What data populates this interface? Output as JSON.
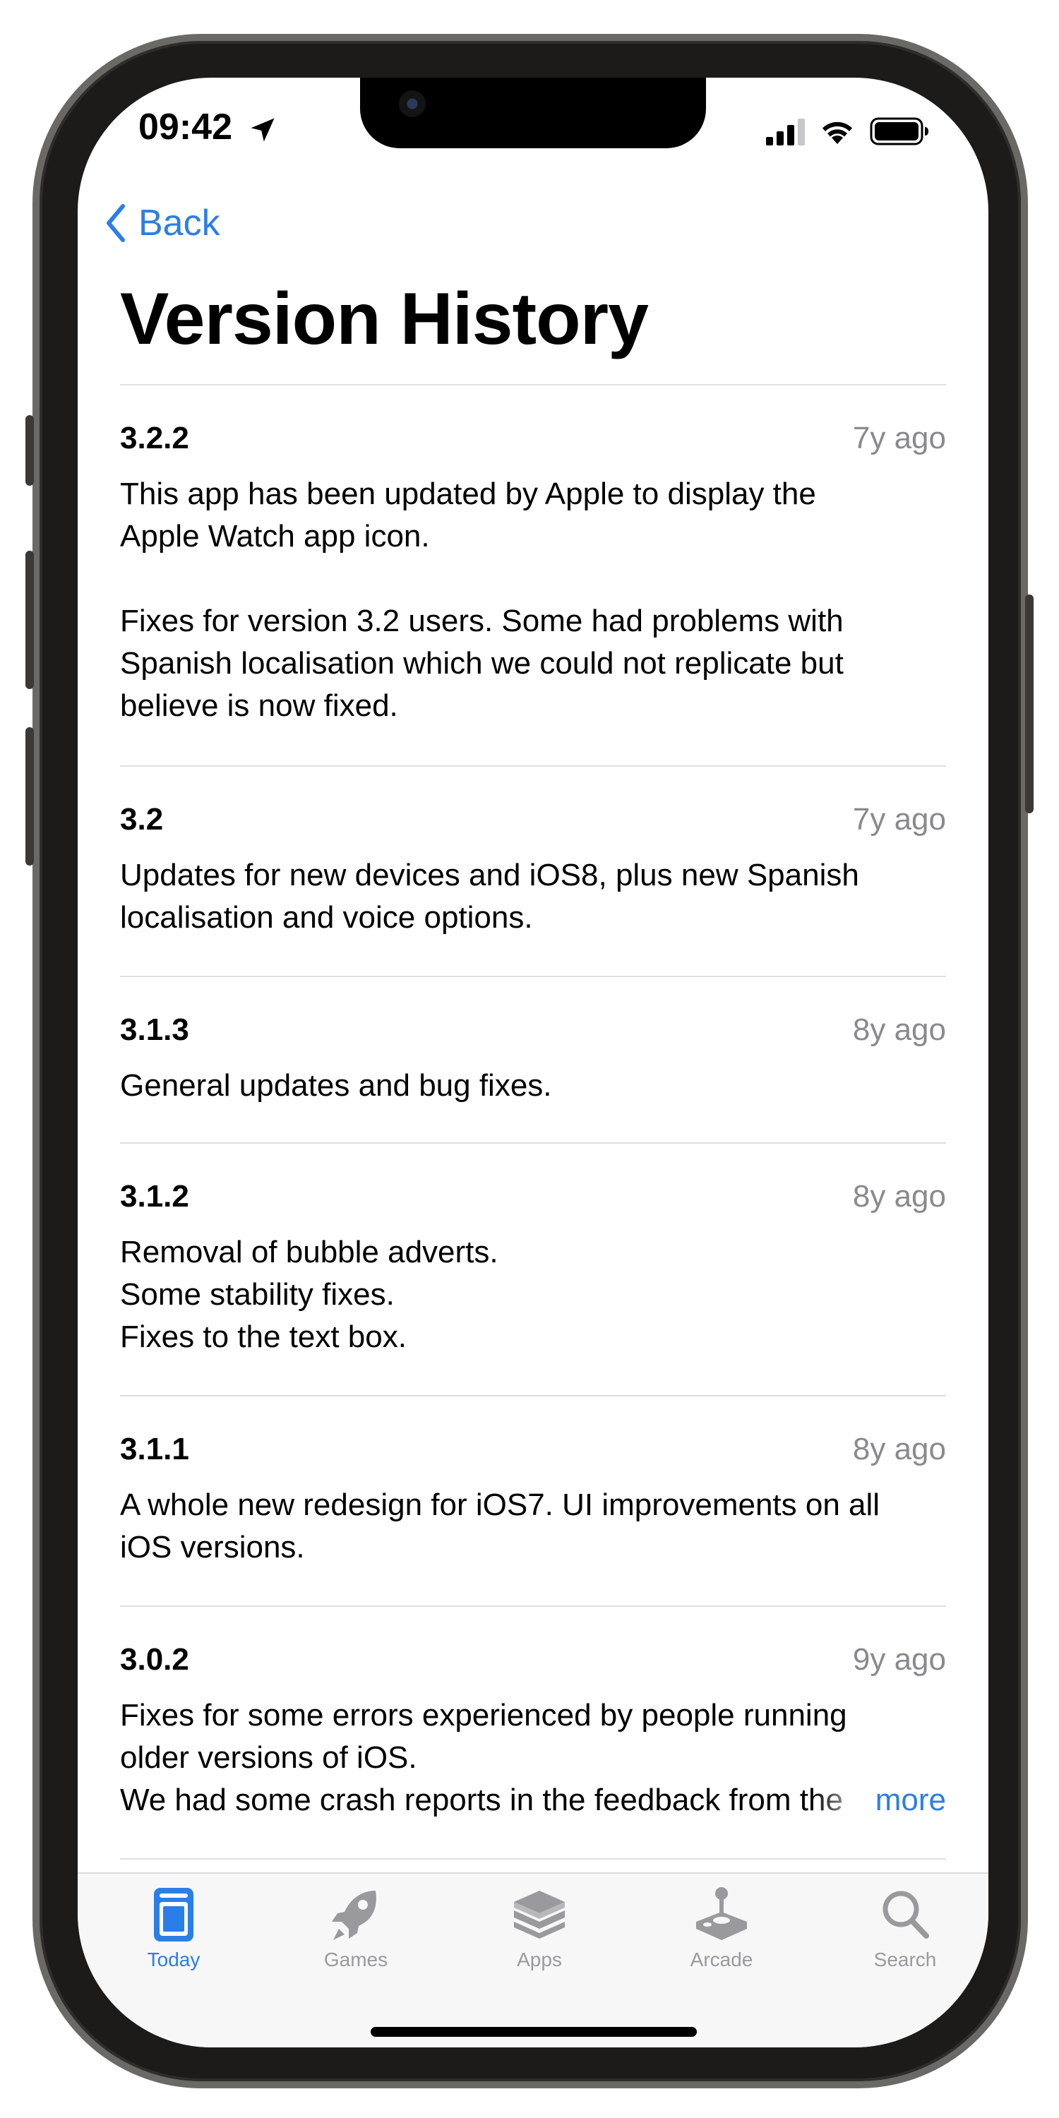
{
  "status_bar": {
    "time": "09:42"
  },
  "nav": {
    "back_label": "Back",
    "title": "Version History"
  },
  "entries": [
    {
      "version": "3.2.2",
      "ago": "7y ago",
      "paragraphs": [
        [
          "This app has been updated by Apple to display the",
          "Apple Watch app icon."
        ],
        [
          "Fixes for version 3.2 users. Some had problems with",
          "Spanish localisation which we could not replicate but",
          "believe is now fixed."
        ]
      ]
    },
    {
      "version": "3.2",
      "ago": "7y ago",
      "lines": [
        "Updates for new devices and iOS8, plus new Spanish",
        "localisation and voice options."
      ]
    },
    {
      "version": "3.1.3",
      "ago": "8y ago",
      "lines": [
        "General updates and bug fixes."
      ]
    },
    {
      "version": "3.1.2",
      "ago": "8y ago",
      "lines": [
        "Removal of bubble adverts.",
        "Some stability fixes.",
        "Fixes to the text box."
      ]
    },
    {
      "version": "3.1.1",
      "ago": "8y ago",
      "lines": [
        "A whole new redesign for iOS7. UI improvements on all",
        "iOS versions."
      ]
    },
    {
      "version": "3.0.2",
      "ago": "9y ago",
      "lines": [
        "Fixes for some errors experienced by people running",
        "older versions of iOS."
      ],
      "truncated_line": "We had some crash reports in the feedback from the",
      "more_label": "more"
    }
  ],
  "tab_bar": {
    "tabs": [
      {
        "label": "Today",
        "icon": "today-icon",
        "active": true
      },
      {
        "label": "Games",
        "icon": "rocket-icon",
        "active": false
      },
      {
        "label": "Apps",
        "icon": "apps-stack-icon",
        "active": false
      },
      {
        "label": "Arcade",
        "icon": "joystick-icon",
        "active": false
      },
      {
        "label": "Search",
        "icon": "search-icon",
        "active": false
      }
    ]
  },
  "colors": {
    "accent": "#2a7ee9",
    "secondary_text": "#8a8a8e",
    "inactive_tab": "#9a9a9e"
  }
}
